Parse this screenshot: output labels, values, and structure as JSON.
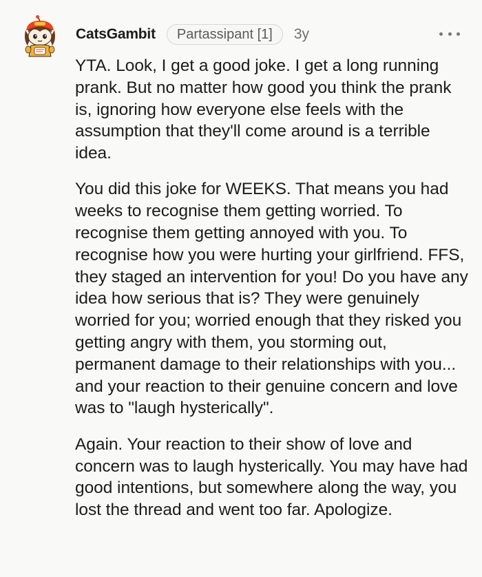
{
  "comment": {
    "username": "CatsGambit",
    "flair": "Partassipant [1]",
    "age": "3y",
    "more_icon": "more-horizontal-icon",
    "avatar_icon": "snoo-avatar-icon",
    "paragraphs": [
      "YTA. Look, I get a good joke. I get a long running prank. But no matter how good you think the prank is, ignoring how everyone else feels with the assumption that they'll come around is a terrible idea.",
      "You did this joke for WEEKS. That means you had weeks to recognise them getting worried. To recognise them getting annoyed with you. To recognise how you were hurting your girlfriend. FFS, they staged an intervention for you! Do you have any idea how serious that is? They were genuinely worried for you; worried enough that they risked you getting angry with them, you storming out, permanent damage to their relationships with you... and your reaction to their genuine concern and love was to \"laugh hysterically\".",
      "Again. Your reaction to their show of love and concern was to laugh hysterically. You may have had good intentions, but somewhere along the way, you lost the thread and went too far. Apologize."
    ]
  },
  "colors": {
    "background": "#f9f9f7",
    "text": "#1c1c1c",
    "meta": "#6e6e6e",
    "avatar_accent": "#e8451e",
    "avatar_hair": "#6b3a1e"
  }
}
